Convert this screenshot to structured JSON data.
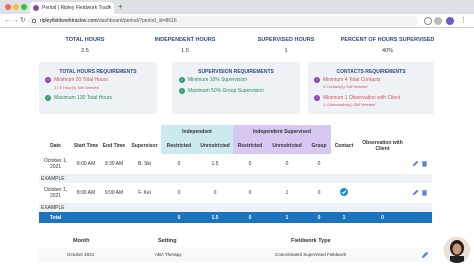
{
  "browser": {
    "tab_title": "Period | Ripley Fieldwork Track",
    "tab_close": "×",
    "new_tab": "+",
    "url_host": "ripleyfieldworktracker.com",
    "url_path": "/dashboard/period/?period_id=8616"
  },
  "stats": [
    {
      "label": "TOTAL HOURS",
      "value": "2.5"
    },
    {
      "label": "INDEPENDENT HOURS",
      "value": "1.5"
    },
    {
      "label": "SUPERVISED HOURS",
      "value": "1"
    },
    {
      "label": "PERCENT OF HOURS SUPERVISED",
      "value": "40%"
    }
  ],
  "requirements": {
    "total": {
      "title": "TOTAL HOURS REQUIREMENTS",
      "items": [
        {
          "text": "Minimum 20 Total Hours",
          "sub": "17.5 Hour(s) Still Needed",
          "status": "fail"
        },
        {
          "text": "Maximum 130 Total Hours",
          "sub": "",
          "status": "ok"
        }
      ]
    },
    "supervision": {
      "title": "SUPERVISION REQUIREMENTS",
      "items": [
        {
          "text": "Minimum 10% Supervision",
          "status": "ok"
        },
        {
          "text": "Maximum 50% Group Supervision",
          "status": "ok"
        }
      ]
    },
    "contacts": {
      "title": "CONTACTS REQUIREMENTS",
      "items": [
        {
          "text": "Minimum 4 Total Contacts",
          "sub": "4 Contact(s) Still Needed",
          "status": "fail"
        },
        {
          "text": "Minimum 1 Observation with Client",
          "sub": "1 Observation(s) Still Needed",
          "status": "fail"
        }
      ]
    }
  },
  "table": {
    "group_independent": "Independent",
    "group_supervised": "Independent Supervised",
    "headers": {
      "date": "Date",
      "start": "Start Time",
      "end": "End Time",
      "supervisor": "Supervisor",
      "restricted": "Restricted",
      "unrestricted": "Unrestricted",
      "restricted2": "Restricted",
      "unrestricted2": "Unrestricted",
      "group": "Group",
      "contact": "Contact",
      "observation": "Observation with Client"
    },
    "rows": [
      {
        "date": "October 1, 2021",
        "start": "8:00 AM",
        "end": "9:30 AM",
        "supervisor": "B. Ski",
        "r": "0",
        "u": "1.5",
        "r2": "0",
        "u2": "0",
        "g": "0",
        "contact": "",
        "label": "EXAMPLE"
      },
      {
        "date": "October 1, 2021",
        "start": "8:00 AM",
        "end": "9:00 AM",
        "supervisor": "F. Kel",
        "r": "0",
        "u": "0",
        "r2": "0",
        "u2": "1",
        "g": "0",
        "contact": "check",
        "label": "EXAMPLE"
      }
    ],
    "total": {
      "label": "Total",
      "r": "0",
      "u": "1.5",
      "r2": "0",
      "u2": "1",
      "g": "0",
      "contact": "1",
      "obs": "0"
    }
  },
  "bottom": {
    "headers": {
      "month": "Month",
      "setting": "Setting",
      "type": "Fieldwork Type"
    },
    "row": {
      "month": "October 2021",
      "setting": "ABA Therapy",
      "type": "Concentrated Supervised Fieldwork"
    }
  },
  "colors": {
    "accent": "#1e73be",
    "fail": "#d9534f",
    "ok": "#2e8b57",
    "independent": "#cce9ef",
    "supervised": "#d7c8f2"
  }
}
